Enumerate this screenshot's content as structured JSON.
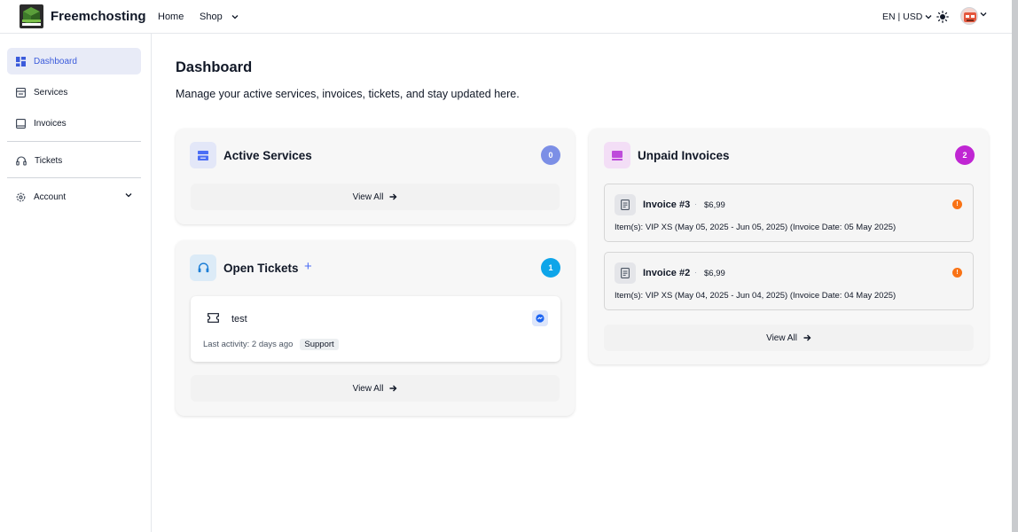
{
  "brand": {
    "name": "Freemchosting"
  },
  "topnav": {
    "home": "Home",
    "shop": "Shop",
    "locale": "EN | USD"
  },
  "sidebar": {
    "items": [
      {
        "label": "Dashboard"
      },
      {
        "label": "Services"
      },
      {
        "label": "Invoices"
      },
      {
        "label": "Tickets"
      },
      {
        "label": "Account"
      }
    ]
  },
  "main": {
    "title": "Dashboard",
    "subtitle": "Manage your active services, invoices, tickets, and stay updated here."
  },
  "active_services": {
    "title": "Active Services",
    "count": "0",
    "view_all": "View All"
  },
  "open_tickets": {
    "title": "Open Tickets",
    "add": "+",
    "count": "1",
    "view_all": "View All",
    "tickets": [
      {
        "title": "test",
        "activity": "Last activity: 2 days ago",
        "tag": "Support"
      }
    ]
  },
  "unpaid_invoices": {
    "title": "Unpaid Invoices",
    "count": "2",
    "view_all": "View All",
    "invoices": [
      {
        "title": "Invoice #3",
        "separator": "·",
        "price": "$6,99",
        "warn": "!",
        "items": "Item(s): VIP XS (May 05, 2025 - Jun 05, 2025) (Invoice Date: 05 May 2025)"
      },
      {
        "title": "Invoice #2",
        "separator": "·",
        "price": "$6,99",
        "warn": "!",
        "items": "Item(s): VIP XS (May 04, 2025 - Jun 04, 2025) (Invoice Date: 04 May 2025)"
      }
    ]
  },
  "colors": {
    "accent": "#3b5bdb",
    "services_badge": "#6b7fe0",
    "tickets_badge": "#0ea5e9",
    "invoices_badge": "#c026d3",
    "warning": "#f97316"
  }
}
